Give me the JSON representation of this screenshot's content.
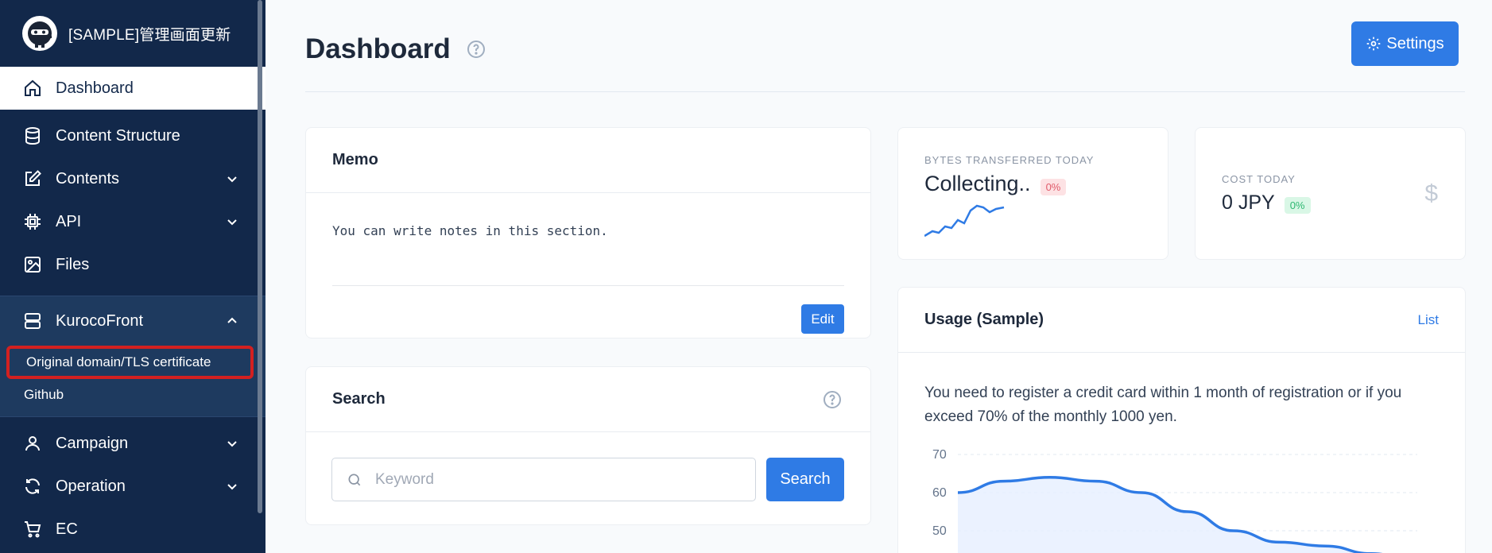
{
  "sidebar": {
    "title": "[SAMPLE]管理画面更新",
    "items": [
      {
        "label": "Dashboard"
      },
      {
        "label": "Content Structure"
      },
      {
        "label": "Contents"
      },
      {
        "label": "API"
      },
      {
        "label": "Files"
      },
      {
        "label": "KurocoFront"
      },
      {
        "label": "Campaign"
      },
      {
        "label": "Operation"
      },
      {
        "label": "EC"
      }
    ],
    "subitems": [
      {
        "label": "Original domain/TLS certificate"
      },
      {
        "label": "Github"
      }
    ]
  },
  "header": {
    "title": "Dashboard",
    "settings_label": "Settings"
  },
  "memo": {
    "title": "Memo",
    "text": "You can write notes in this section.",
    "edit_label": "Edit"
  },
  "search": {
    "title": "Search",
    "placeholder": "Keyword",
    "button_label": "Search"
  },
  "stats": {
    "bytes": {
      "label": "BYTES TRANSFERRED TODAY",
      "value": "Collecting..",
      "badge": "0%"
    },
    "cost": {
      "label": "COST TODAY",
      "value": "0 JPY",
      "badge": "0%"
    }
  },
  "usage": {
    "title": "Usage (Sample)",
    "link_label": "List",
    "text": "You need to register a credit card within 1 month of registration or if you exceed 70% of the monthly 1000 yen.",
    "chart_data": {
      "type": "area",
      "y_ticks": [
        "70",
        "60",
        "50"
      ],
      "ylim": [
        40,
        70
      ],
      "values": [
        60,
        63,
        64,
        63,
        60,
        55,
        50,
        47,
        46,
        44,
        42
      ]
    }
  },
  "colors": {
    "sidebar_bg": "#12284a",
    "accent": "#2f7be5",
    "highlight_border": "#d32020"
  }
}
